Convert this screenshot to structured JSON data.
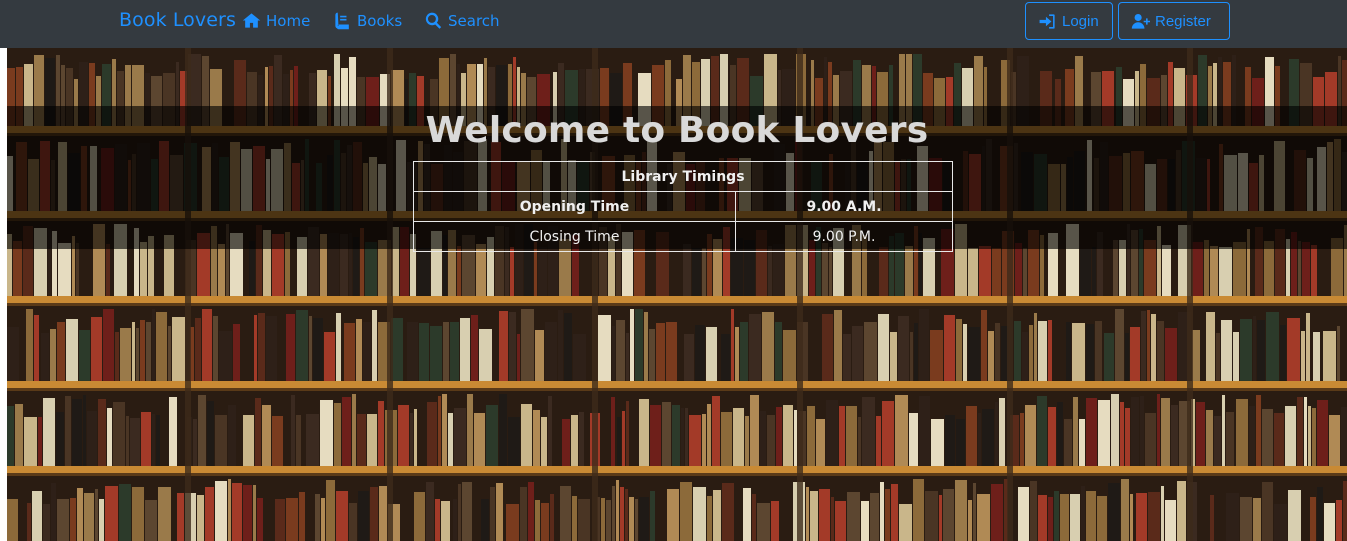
{
  "nav": {
    "brand": "Book Lovers",
    "links": [
      {
        "label": "Home",
        "icon": "home-icon"
      },
      {
        "label": "Books",
        "icon": "book-icon"
      },
      {
        "label": "Search",
        "icon": "search-icon"
      }
    ],
    "login_label": "Login",
    "register_label": "Register"
  },
  "hero": {
    "title": "Welcome to Book Lovers",
    "table": {
      "header": "Library Timings",
      "rows": [
        {
          "label": "Opening Time",
          "value": "9.00 A.M."
        },
        {
          "label": "Closing Time",
          "value": "9.00 P.M."
        }
      ]
    }
  },
  "colors": {
    "navbar_bg": "#343a40",
    "accent": "#1e90ff",
    "overlay": "rgba(0,0,0,0.62)"
  }
}
